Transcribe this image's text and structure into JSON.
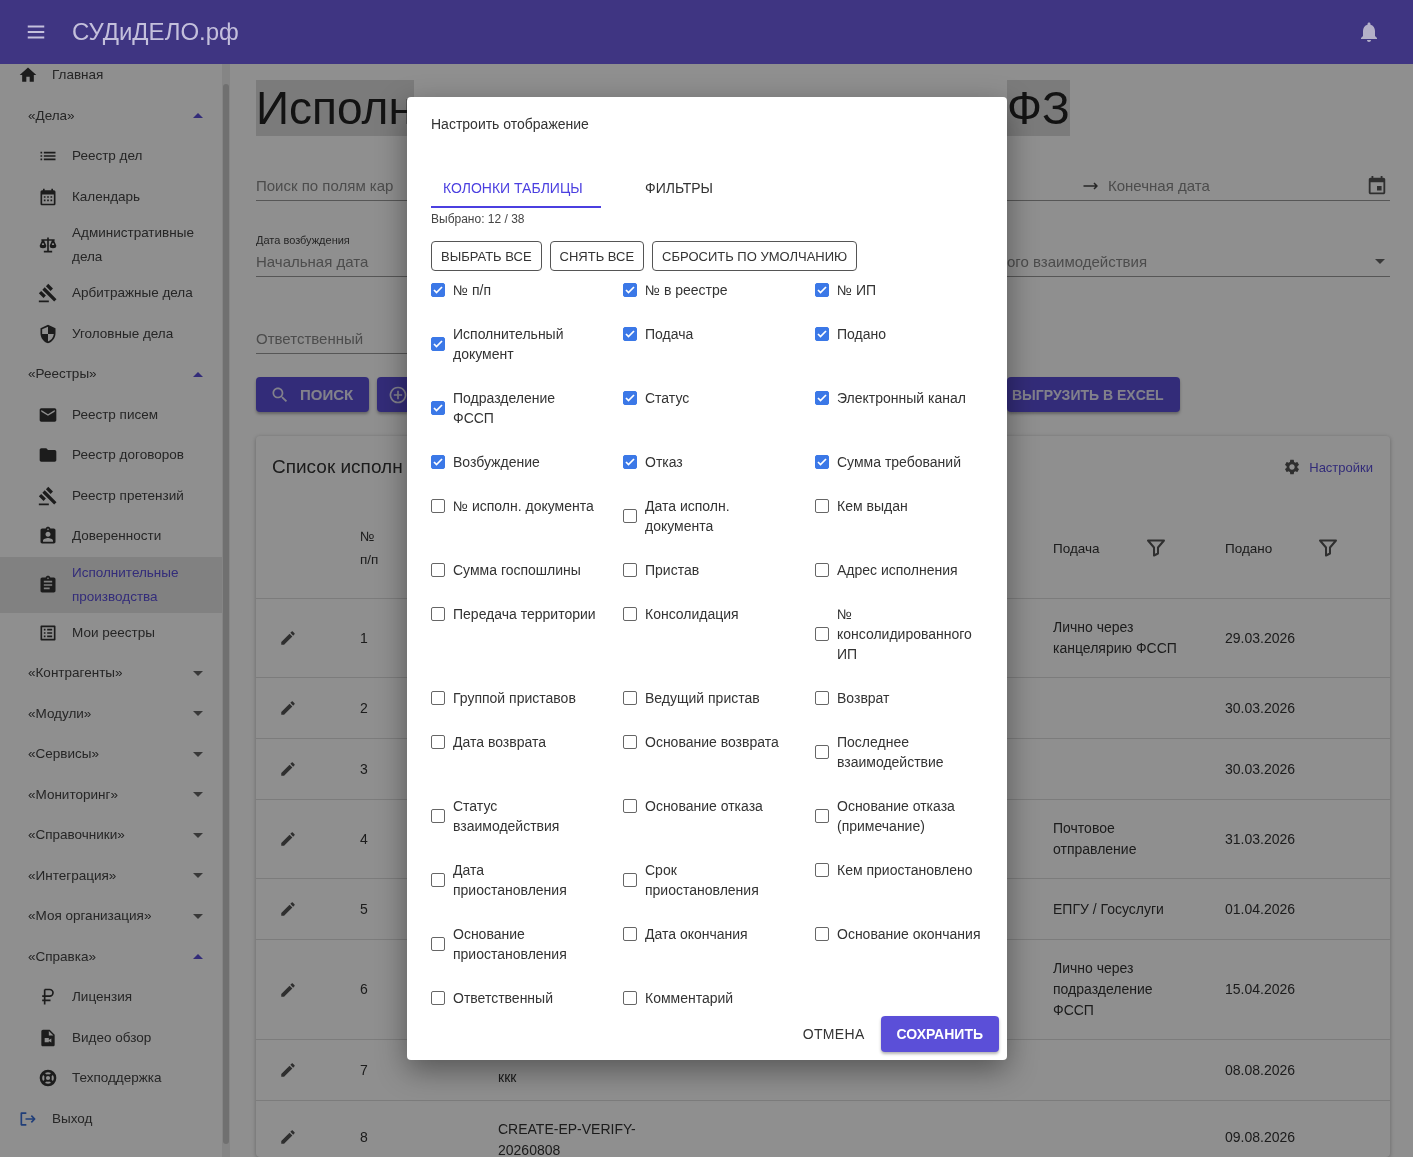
{
  "header": {
    "title": "СУДиДЕЛО.рф"
  },
  "sidebar": {
    "items": [
      {
        "kind": "link",
        "label": "Главная"
      },
      {
        "kind": "group",
        "label": "«Дела»",
        "expanded": true,
        "children": [
          {
            "label": "Реестр дел",
            "selected": false
          },
          {
            "label": "Календарь",
            "selected": false
          },
          {
            "label": "Административные дела",
            "selected": false
          },
          {
            "label": "Арбитражные дела",
            "selected": false
          },
          {
            "label": "Уголовные дела",
            "selected": false
          }
        ]
      },
      {
        "kind": "group",
        "label": "«Реестры»",
        "expanded": true,
        "children": [
          {
            "label": "Реестр писем",
            "selected": false
          },
          {
            "label": "Реестр договоров",
            "selected": false
          },
          {
            "label": "Реестр претензий",
            "selected": false
          },
          {
            "label": "Доверенности",
            "selected": false
          },
          {
            "label": "Исполнительные производства",
            "selected": true
          },
          {
            "label": "Мои реестры",
            "selected": false
          }
        ]
      },
      {
        "kind": "group",
        "label": "«Контрагенты»",
        "expanded": false
      },
      {
        "kind": "group",
        "label": "«Модули»",
        "expanded": false
      },
      {
        "kind": "group",
        "label": "«Сервисы»",
        "expanded": false
      },
      {
        "kind": "group",
        "label": "«Мониторинг»",
        "expanded": false
      },
      {
        "kind": "group",
        "label": "«Справочники»",
        "expanded": false
      },
      {
        "kind": "group",
        "label": "«Интеграция»",
        "expanded": false
      },
      {
        "kind": "group",
        "label": "«Моя организация»",
        "expanded": false
      },
      {
        "kind": "group",
        "label": "«Справка»",
        "expanded": true,
        "children": [
          {
            "label": "Лицензия",
            "selected": false
          },
          {
            "label": "Видео обзор",
            "selected": false
          },
          {
            "label": "Техподдержка",
            "selected": false
          }
        ]
      },
      {
        "kind": "link",
        "label": "Выход"
      }
    ]
  },
  "page": {
    "title": {
      "left_part": "Исполн",
      "right_part": "ФЗ"
    }
  },
  "filters": {
    "search": {
      "placeholder": "Поиск по полям кар"
    },
    "date_range": {
      "label": "Дата возбуждения",
      "start_placeholder": "Начальная дата",
      "end_placeholder": "Конечная дата"
    },
    "status_select": {
      "placeholder": "ого взаимодействия"
    },
    "responsible": {
      "placeholder": "Ответственный"
    }
  },
  "actions": [
    {
      "kind": "search",
      "label": "ПОИСК"
    },
    {
      "kind": "add"
    },
    {
      "kind": "export",
      "label": "ВЫГРУЗИТЬ В EXCEL"
    }
  ],
  "list": {
    "title": "Список исполн",
    "settings_link": "Настройки",
    "columns": [
      {
        "label": "№ п/п",
        "filter": false
      },
      {
        "label": "Подача",
        "filter": true
      },
      {
        "label": "Подано",
        "filter": true
      }
    ],
    "rows": [
      {
        "number": "1",
        "channel": "Лично через канцелярию ФССП",
        "date": "29.03.2026"
      },
      {
        "number": "2",
        "date": "30.03.2026"
      },
      {
        "number": "3",
        "date": "30.03.2026"
      },
      {
        "number": "4",
        "channel": "Почтовое отправление",
        "date": "31.03.2026"
      },
      {
        "number": "5",
        "channel": "ЕПГУ / Госуслуги",
        "date": "01.04.2026"
      },
      {
        "number": "6",
        "channel": "Лично через подразделение ФССП",
        "date": "15.04.2026"
      },
      {
        "number": "7",
        "column_3": "ккк",
        "date": "08.08.2026"
      },
      {
        "number": "8",
        "column_3": "CREATE-EP-VERIFY-20260808",
        "date": "09.08.2026"
      }
    ]
  },
  "settings_dialog": {
    "title": "Настроить отображение",
    "tabs": [
      {
        "label": "КОЛОНКИ ТАБЛИЦЫ",
        "selected": true
      },
      {
        "label": "ФИЛЬТРЫ",
        "selected": false
      }
    ],
    "selection_count": "Выбрано: 12 / 38",
    "bulk_actions": [
      "ВЫБРАТЬ ВСЕ",
      "СНЯТЬ ВСЕ",
      "СБРОСИТЬ ПО УМОЛЧАНИЮ"
    ],
    "columns": [
      {
        "label": "№ п/п",
        "checked": true
      },
      {
        "label": "№ в реестре",
        "checked": true
      },
      {
        "label": "№ ИП",
        "checked": true
      },
      {
        "label": "Исполнительный документ",
        "checked": true
      },
      {
        "label": "Подача",
        "checked": true
      },
      {
        "label": "Подано",
        "checked": true
      },
      {
        "label": "Подразделение ФССП",
        "checked": true
      },
      {
        "label": "Статус",
        "checked": true
      },
      {
        "label": "Электронный канал",
        "checked": true
      },
      {
        "label": "Возбуждение",
        "checked": true
      },
      {
        "label": "Отказ",
        "checked": true
      },
      {
        "label": "Сумма требований",
        "checked": true
      },
      {
        "label": "№ исполн. документа",
        "checked": false
      },
      {
        "label": "Дата исполн. документа",
        "checked": false
      },
      {
        "label": "Кем выдан",
        "checked": false
      },
      {
        "label": "Сумма госпошлины",
        "checked": false
      },
      {
        "label": "Пристав",
        "checked": false
      },
      {
        "label": "Адрес исполнения",
        "checked": false
      },
      {
        "label": "Передача территории",
        "checked": false
      },
      {
        "label": "Консолидация",
        "checked": false
      },
      {
        "label": "№ консолидированного ИП",
        "checked": false
      },
      {
        "label": "Группой приставов",
        "checked": false
      },
      {
        "label": "Ведущий пристав",
        "checked": false
      },
      {
        "label": "Возврат",
        "checked": false
      },
      {
        "label": "Дата возврата",
        "checked": false
      },
      {
        "label": "Основание возврата",
        "checked": false
      },
      {
        "label": "Последнее взаимодействие",
        "checked": false
      },
      {
        "label": "Статус взаимодействия",
        "checked": false
      },
      {
        "label": "Основание отказа",
        "checked": false
      },
      {
        "label": "Основание отказа (примечание)",
        "checked": false
      },
      {
        "label": "Дата приостановления",
        "checked": false
      },
      {
        "label": "Срок приостановления",
        "checked": false
      },
      {
        "label": "Кем приостановлено",
        "checked": false
      },
      {
        "label": "Основание приостановления",
        "checked": false
      },
      {
        "label": "Дата окончания",
        "checked": false
      },
      {
        "label": "Основание окончания",
        "checked": false
      },
      {
        "label": "Ответственный",
        "checked": false
      },
      {
        "label": "Комментарий",
        "checked": false
      }
    ],
    "buttons": [
      {
        "kind": "text",
        "label": "ОТМЕНА"
      },
      {
        "kind": "primary",
        "label": "СОХРАНИТЬ"
      }
    ]
  }
}
